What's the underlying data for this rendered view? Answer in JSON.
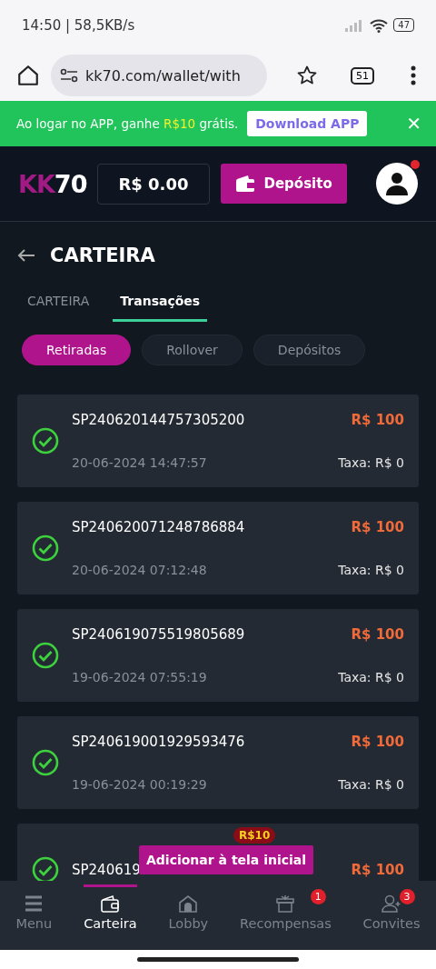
{
  "status_bar": {
    "time_speed": "14:50 | 58,5KB/s",
    "battery": "47"
  },
  "browser": {
    "url": "kk70.com/wallet/with",
    "tab_count": "51"
  },
  "banner": {
    "text": "Ao logar no APP, ganhe **R$10** grátis.",
    "button": "Download APP",
    "close": "✕"
  },
  "header": {
    "logo_a": "KK",
    "logo_b": "70",
    "balance": "R$ 0.00",
    "deposit": "Depósito",
    "notification": true
  },
  "page": {
    "title": "CARTEIRA"
  },
  "tabs": [
    {
      "label": "CARTEIRA",
      "selected": false
    },
    {
      "label": "Transações",
      "selected": true
    }
  ],
  "filters": [
    {
      "label": "Retiradas",
      "selected": true
    },
    {
      "label": "Rollover",
      "selected": false
    },
    {
      "label": "Depósitos",
      "selected": false
    }
  ],
  "transactions": [
    {
      "id": "SP240620144757305200",
      "amount": "R$ 100",
      "date": "20-06-2024 14:47:57",
      "fee": "Taxa: R$ 0"
    },
    {
      "id": "SP240620071248786884",
      "amount": "R$ 100",
      "date": "20-06-2024 07:12:48",
      "fee": "Taxa: R$ 0"
    },
    {
      "id": "SP240619075519805689",
      "amount": "R$ 100",
      "date": "19-06-2024 07:55:19",
      "fee": "Taxa: R$ 0"
    },
    {
      "id": "SP240619001929593476",
      "amount": "R$ 100",
      "date": "19-06-2024 00:19:29",
      "fee": "Taxa: R$ 0"
    },
    {
      "id": "SP240619",
      "amount": "R$ 100"
    }
  ],
  "popup": {
    "badge": "R$10",
    "label": "Adicionar à tela inicial"
  },
  "nav": [
    {
      "label": "Menu",
      "selected": false
    },
    {
      "label": "Carteira",
      "selected": true
    },
    {
      "label": "Lobby",
      "selected": false
    },
    {
      "label": "Recompensas",
      "selected": false,
      "badge": "1"
    },
    {
      "label": "Convites",
      "selected": false,
      "badge": "3"
    }
  ]
}
